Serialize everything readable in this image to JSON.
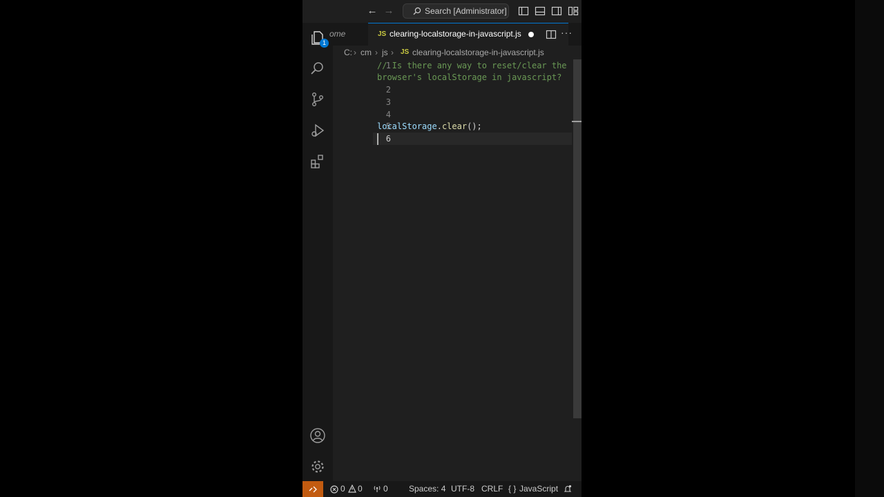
{
  "titlebar": {
    "search_label": "Search [Administrator]"
  },
  "activity": {
    "explorer_badge": "1"
  },
  "tabs": {
    "home_label": "ome",
    "active_label": "clearing-localstorage-in-javascript.js",
    "active_badge": "JS"
  },
  "breadcrumb": {
    "items": [
      "C:",
      "cm",
      "js",
      "clearing-localstorage-in-javascript.js"
    ],
    "file_badge": "JS"
  },
  "editor": {
    "line_numbers": [
      "1",
      "2",
      "3",
      "4",
      "5",
      "6"
    ],
    "comment_line1": "// Is there any way to reset/clear the",
    "comment_line2": "browser's localStorage in javascript?",
    "code_obj": "localStorage",
    "code_dot": ".",
    "code_fn": "clear",
    "code_end": "();"
  },
  "status": {
    "errors": "0",
    "warnings": "0",
    "ports": "0",
    "spaces": "Spaces: 4",
    "encoding": "UTF-8",
    "eol": "CRLF",
    "language": "JavaScript",
    "language_icon": "{ }"
  },
  "colors": {
    "accent": "#0078d4",
    "remote": "#c25b10",
    "comment": "#6a9955",
    "variable": "#9cdcfe",
    "function": "#dcdcaa",
    "js_badge": "#cbcb41"
  }
}
